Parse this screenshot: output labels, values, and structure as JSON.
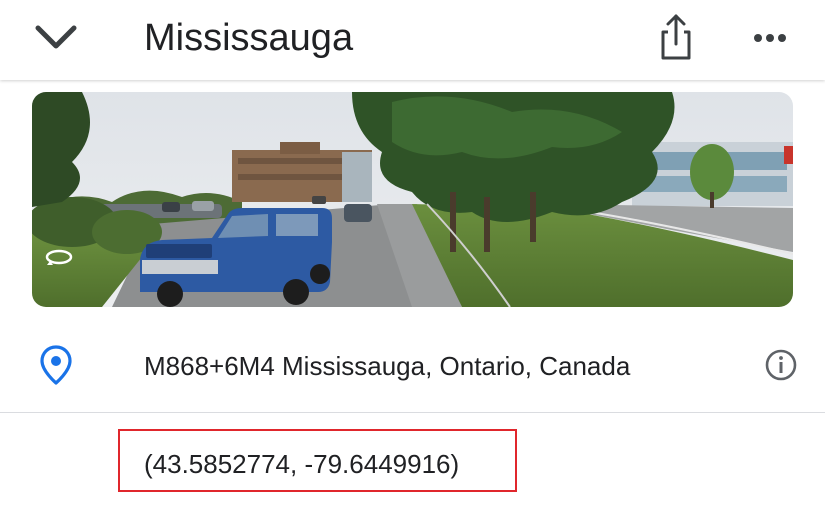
{
  "header": {
    "title": "Mississauga",
    "back_icon": "chevron-down-icon",
    "share_icon": "share-icon",
    "more_icon": "more-horizontal-icon"
  },
  "street_view": {
    "icon": "street-view-rotate-icon"
  },
  "address": {
    "icon": "location-pin-icon",
    "text": "M868+6M4 Mississauga, Ontario, Canada",
    "info_icon": "info-icon"
  },
  "coordinates": {
    "text": "(43.5852774, -79.6449916)",
    "highlight_color": "#e0262c"
  },
  "colors": {
    "pin_blue": "#1a73e8",
    "text": "#202124",
    "icon_gray": "#5f6368"
  }
}
